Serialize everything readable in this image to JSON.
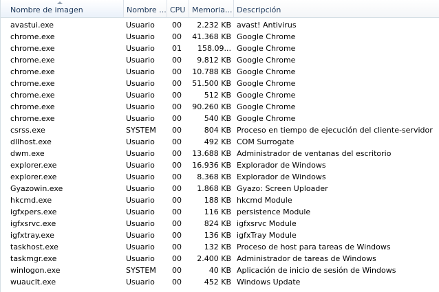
{
  "columns": {
    "name": "Nombre de imagen",
    "user": "Nombre ...",
    "cpu": "CPU",
    "memory": "Memoria...",
    "description": "Descripción"
  },
  "processes": [
    {
      "name": "avastui.exe",
      "user": "Usuario",
      "cpu": "00",
      "memory": "2.232 KB",
      "description": "avast! Antivirus"
    },
    {
      "name": "chrome.exe",
      "user": "Usuario",
      "cpu": "00",
      "memory": "41.368 KB",
      "description": "Google Chrome"
    },
    {
      "name": "chrome.exe",
      "user": "Usuario",
      "cpu": "01",
      "memory": "158.09...",
      "description": "Google Chrome"
    },
    {
      "name": "chrome.exe",
      "user": "Usuario",
      "cpu": "00",
      "memory": "9.812 KB",
      "description": "Google Chrome"
    },
    {
      "name": "chrome.exe",
      "user": "Usuario",
      "cpu": "00",
      "memory": "10.788 KB",
      "description": "Google Chrome"
    },
    {
      "name": "chrome.exe",
      "user": "Usuario",
      "cpu": "00",
      "memory": "51.500 KB",
      "description": "Google Chrome"
    },
    {
      "name": "chrome.exe",
      "user": "Usuario",
      "cpu": "00",
      "memory": "512 KB",
      "description": "Google Chrome"
    },
    {
      "name": "chrome.exe",
      "user": "Usuario",
      "cpu": "00",
      "memory": "90.260 KB",
      "description": "Google Chrome"
    },
    {
      "name": "chrome.exe",
      "user": "Usuario",
      "cpu": "00",
      "memory": "540 KB",
      "description": "Google Chrome"
    },
    {
      "name": "csrss.exe",
      "user": "SYSTEM",
      "cpu": "00",
      "memory": "804 KB",
      "description": "Proceso en tiempo de ejecución del cliente-servidor"
    },
    {
      "name": "dllhost.exe",
      "user": "Usuario",
      "cpu": "00",
      "memory": "492 KB",
      "description": "COM Surrogate"
    },
    {
      "name": "dwm.exe",
      "user": "Usuario",
      "cpu": "00",
      "memory": "13.688 KB",
      "description": "Administrador de ventanas del escritorio"
    },
    {
      "name": "explorer.exe",
      "user": "Usuario",
      "cpu": "00",
      "memory": "16.936 KB",
      "description": "Explorador de Windows"
    },
    {
      "name": "explorer.exe",
      "user": "Usuario",
      "cpu": "00",
      "memory": "8.368 KB",
      "description": "Explorador de Windows"
    },
    {
      "name": "Gyazowin.exe",
      "user": "Usuario",
      "cpu": "00",
      "memory": "1.868 KB",
      "description": "Gyazo: Screen Uploader"
    },
    {
      "name": "hkcmd.exe",
      "user": "Usuario",
      "cpu": "00",
      "memory": "188 KB",
      "description": "hkcmd Module"
    },
    {
      "name": "igfxpers.exe",
      "user": "Usuario",
      "cpu": "00",
      "memory": "116 KB",
      "description": "persistence Module"
    },
    {
      "name": "igfxsrvc.exe",
      "user": "Usuario",
      "cpu": "00",
      "memory": "824 KB",
      "description": "igfxsrvc Module"
    },
    {
      "name": "igfxtray.exe",
      "user": "Usuario",
      "cpu": "00",
      "memory": "136 KB",
      "description": "igfxTray Module"
    },
    {
      "name": "taskhost.exe",
      "user": "Usuario",
      "cpu": "00",
      "memory": "132 KB",
      "description": "Proceso de host para tareas de Windows"
    },
    {
      "name": "taskmgr.exe",
      "user": "Usuario",
      "cpu": "00",
      "memory": "2.400 KB",
      "description": "Administrador de tareas de Windows"
    },
    {
      "name": "winlogon.exe",
      "user": "SYSTEM",
      "cpu": "00",
      "memory": "40 KB",
      "description": "Aplicación de inicio de sesión de Windows"
    },
    {
      "name": "wuauclt.exe",
      "user": "Usuario",
      "cpu": "00",
      "memory": "452 KB",
      "description": "Windows Update"
    }
  ]
}
